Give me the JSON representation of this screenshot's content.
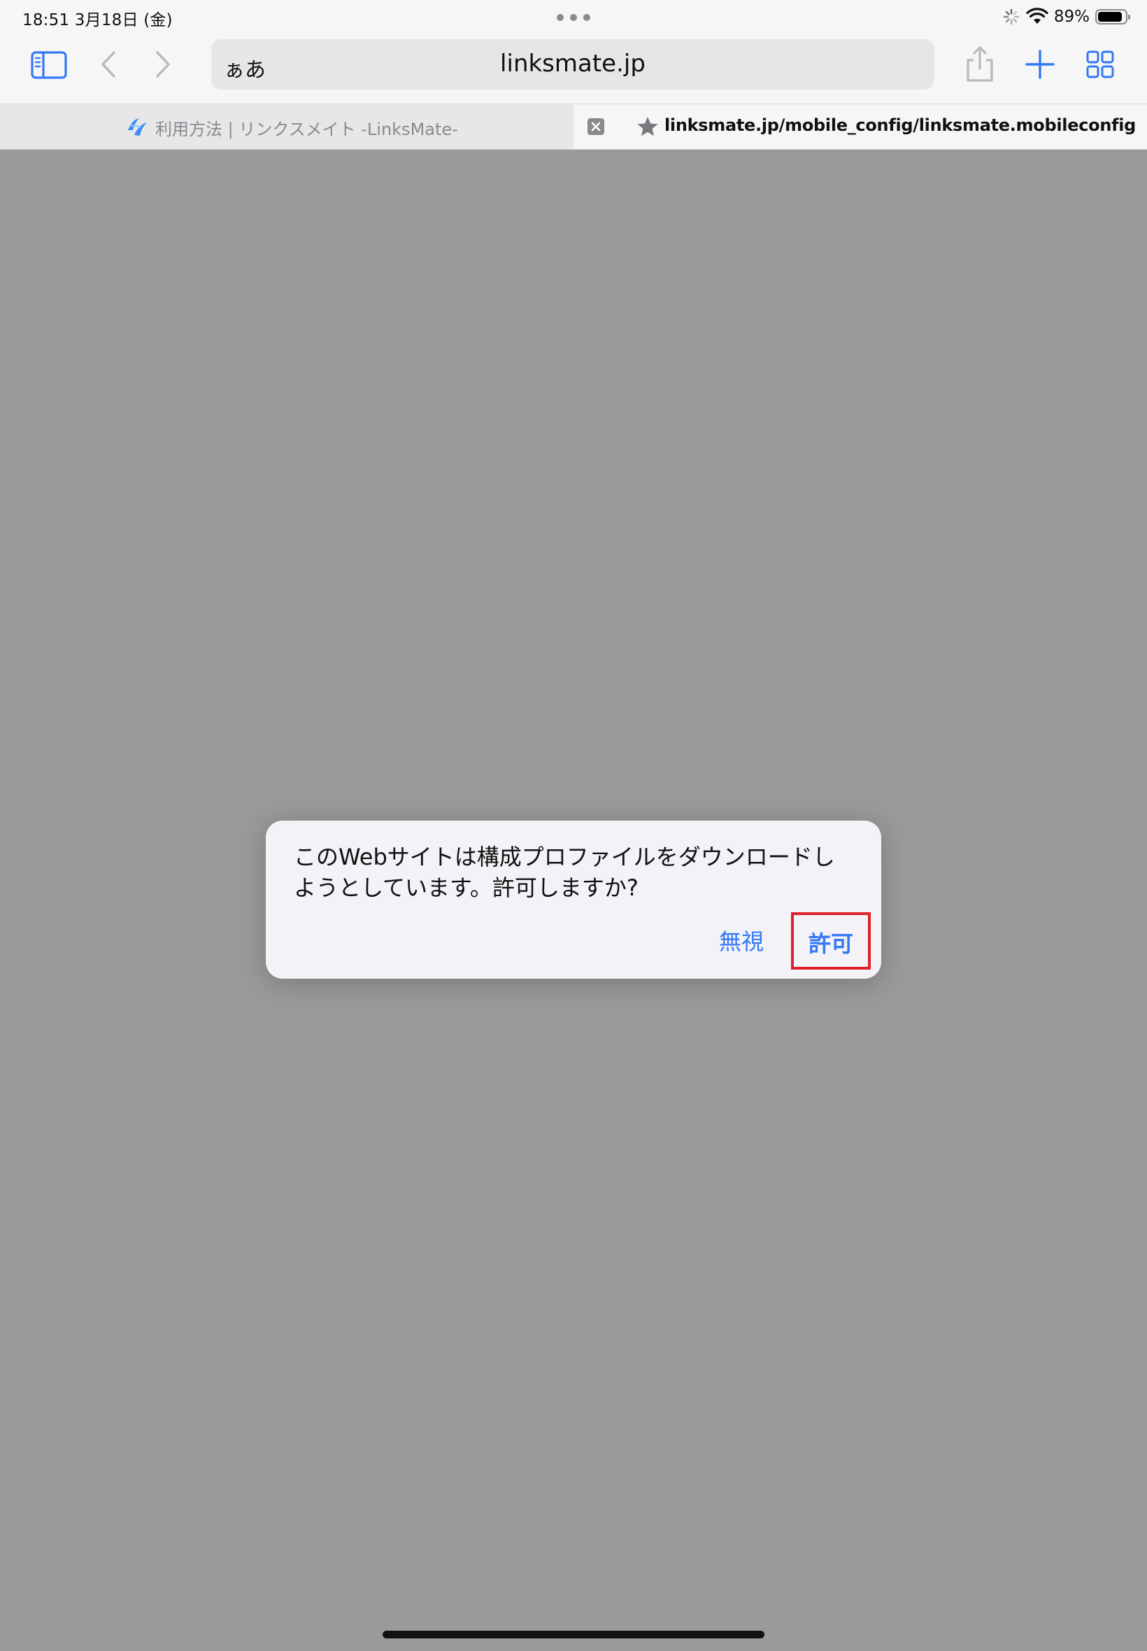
{
  "status_bar": {
    "time_date": "18:51   3月18日 (金)",
    "battery_percent": "89%",
    "battery_level": 0.89
  },
  "toolbar": {
    "reader_label": "ぁあ",
    "url": "linksmate.jp",
    "icons": {
      "sidebar": "sidebar-icon",
      "back": "back-chevron-icon",
      "forward": "forward-chevron-icon",
      "share": "share-icon",
      "new_tab": "plus-icon",
      "tab_overview": "grid-icon"
    }
  },
  "tabs": [
    {
      "title": "利用方法 | リンクスメイト -LinksMate-",
      "active": false
    },
    {
      "title": "linksmate.jp/mobile_config/linksmate.mobileconfig",
      "active": true
    }
  ],
  "dialog": {
    "message": "このWebサイトは構成プロファイルをダウンロードしようとしています。許可しますか?",
    "ignore_label": "無視",
    "allow_label": "許可"
  },
  "colors": {
    "accent": "#3478f6",
    "highlight_border": "#e0202a",
    "page_background": "#9a9a9a"
  }
}
